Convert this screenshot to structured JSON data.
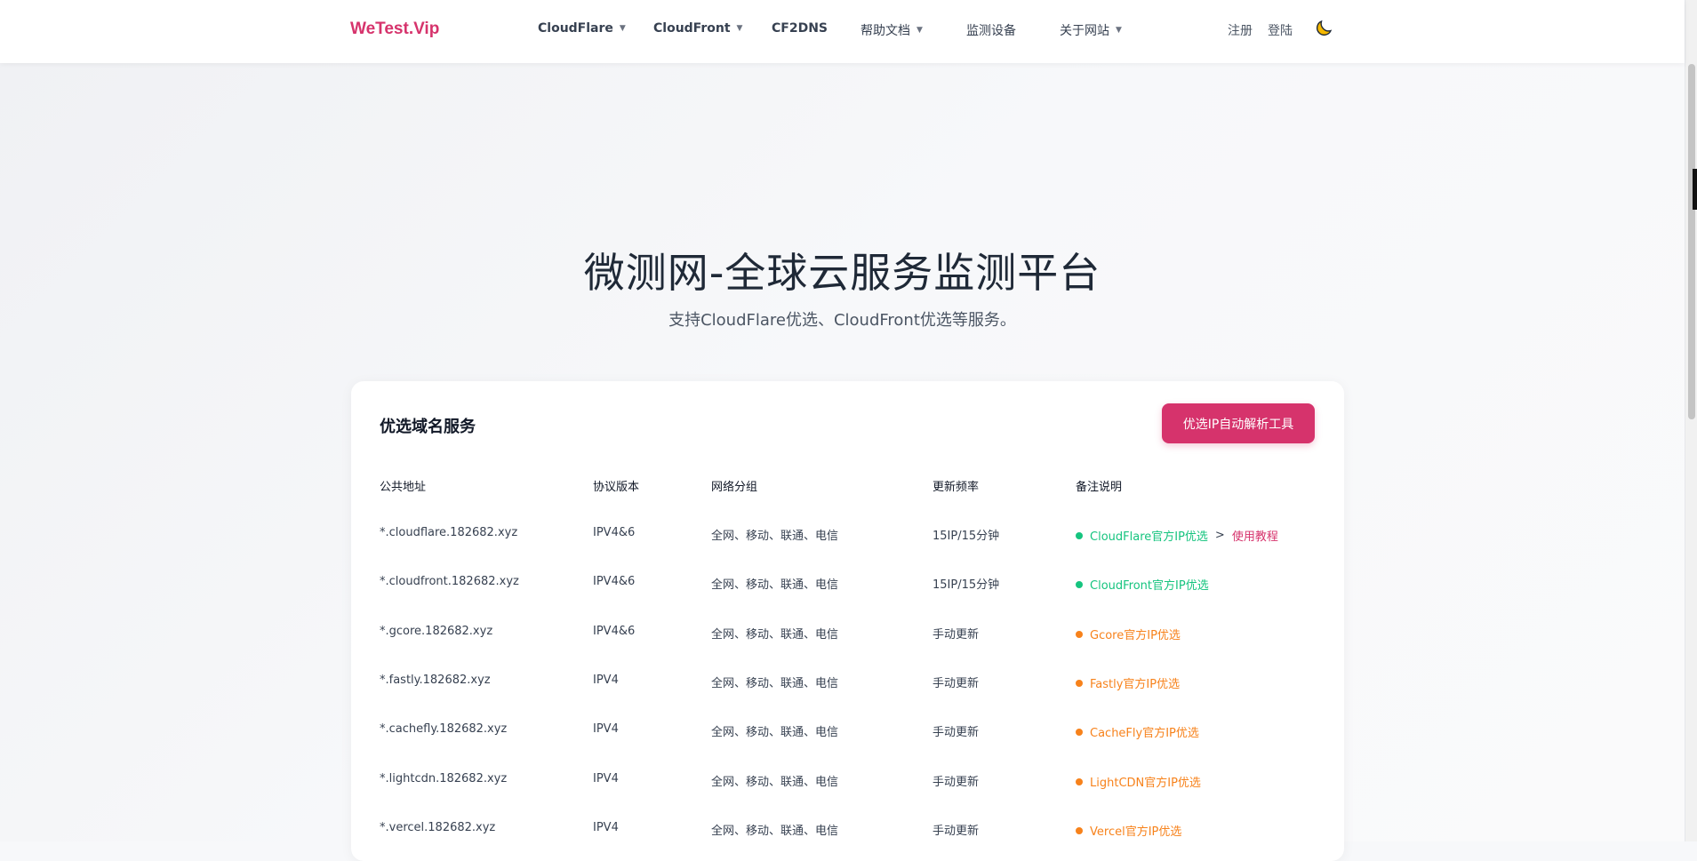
{
  "nav": {
    "logo": "WeTest.Vip",
    "items": [
      {
        "label": "CloudFlare",
        "has_caret": true,
        "caret": "▼"
      },
      {
        "label": "CloudFront",
        "has_caret": true,
        "caret": "▼"
      },
      {
        "label": "CF2DNS",
        "has_caret": false
      },
      {
        "label": "帮助文档",
        "has_caret": true,
        "caret": "▼"
      },
      {
        "label": "监测设备",
        "has_caret": false
      },
      {
        "label": "关于网站",
        "has_caret": true,
        "caret": "▼"
      }
    ],
    "register": "注册",
    "login": "登陆",
    "theme_icon": "moon-icon"
  },
  "hero": {
    "title": "微测网-全球云服务监测平台",
    "subtitle": "支持CloudFlare优选、CloudFront优选等服务。"
  },
  "card": {
    "title": "优选域名服务",
    "tool_button": "优选IP自动解析工具",
    "headers": [
      "公共地址",
      "协议版本",
      "网络分组",
      "更新频率",
      "备注说明"
    ],
    "rows": [
      {
        "address": "*.cloudflare.182682.xyz",
        "protocol": "IPV4&6",
        "network": "全网、移动、联通、电信",
        "frequency": "15IP/15分钟",
        "note": "CloudFlare官方IP优选",
        "note_color": "#16c47f",
        "sep": ">",
        "tutorial": "使用教程"
      },
      {
        "address": "*.cloudfront.182682.xyz",
        "protocol": "IPV4&6",
        "network": "全网、移动、联通、电信",
        "frequency": "15IP/15分钟",
        "note": "CloudFront官方IP优选",
        "note_color": "#16c47f"
      },
      {
        "address": "*.gcore.182682.xyz",
        "protocol": "IPV4&6",
        "network": "全网、移动、联通、电信",
        "frequency": "手动更新",
        "note": "Gcore官方IP优选",
        "note_color": "#f7821b"
      },
      {
        "address": "*.fastly.182682.xyz",
        "protocol": "IPV4",
        "network": "全网、移动、联通、电信",
        "frequency": "手动更新",
        "note": "Fastly官方IP优选",
        "note_color": "#f7821b"
      },
      {
        "address": "*.cachefly.182682.xyz",
        "protocol": "IPV4",
        "network": "全网、移动、联通、电信",
        "frequency": "手动更新",
        "note": "CacheFly官方IP优选",
        "note_color": "#f7821b"
      },
      {
        "address": "*.lightcdn.182682.xyz",
        "protocol": "IPV4",
        "network": "全网、移动、联通、电信",
        "frequency": "手动更新",
        "note": "LightCDN官方IP优选",
        "note_color": "#f7821b"
      },
      {
        "address": "*.vercel.182682.xyz",
        "protocol": "IPV4",
        "network": "全网、移动、联通、电信",
        "frequency": "手动更新",
        "note": "Vercel官方IP优选",
        "note_color": "#f7821b"
      }
    ]
  },
  "colors": {
    "brand": "#d6336c",
    "green": "#16c47f",
    "orange": "#f7821b"
  }
}
